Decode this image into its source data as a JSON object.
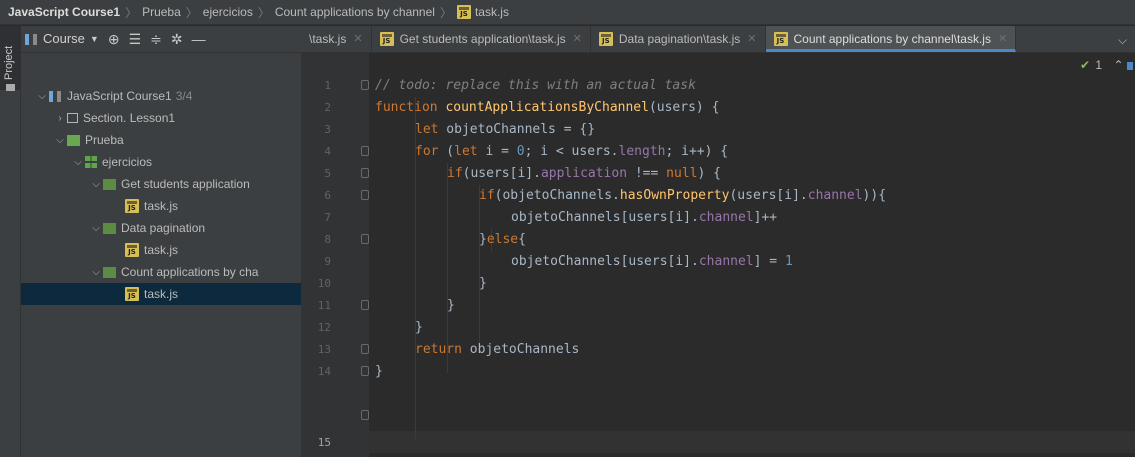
{
  "breadcrumb": {
    "items": [
      "JavaScript Course1",
      "Prueba",
      "ejercicios",
      "Count applications by channel",
      "task.js"
    ]
  },
  "sidestrip": {
    "project_label": "Project"
  },
  "toolbar": {
    "course_label": "Course"
  },
  "tree": {
    "course": {
      "label": "JavaScript Course1",
      "progress": "3/4"
    },
    "section": {
      "label": "Section. Lesson1"
    },
    "prueba": {
      "label": "Prueba"
    },
    "ejercicios": {
      "label": "ejercicios"
    },
    "lessons": [
      {
        "label": "Get students application",
        "file": "task.js"
      },
      {
        "label": "Data pagination",
        "file": "task.js"
      },
      {
        "label": "Count applications by cha",
        "file": "task.js"
      }
    ]
  },
  "tabs": [
    {
      "label": "\\task.js",
      "active": false
    },
    {
      "label": "Get students application\\task.js",
      "active": false
    },
    {
      "label": "Data pagination\\task.js",
      "active": false
    },
    {
      "label": "Count applications by channel\\task.js",
      "active": true
    }
  ],
  "inspection": {
    "count": "1"
  },
  "editor": {
    "current_line": 15,
    "line_numbers": [
      "1",
      "2",
      "3",
      "4",
      "5",
      "6",
      "7",
      "8",
      "9",
      "10",
      "11",
      "12",
      "13",
      "14",
      "15"
    ],
    "code": {
      "l1": "// todo: replace this with an actual task",
      "l2_kw": "function",
      "l2_fn": "countApplicationsByChannel",
      "l2_rest": "(users) {",
      "l3_kw": "let",
      "l3_rest": " objetoChannels = {}",
      "l4_kw1": "for",
      "l4_a": " (",
      "l4_kw2": "let",
      "l4_b": " i = ",
      "l4_num": "0",
      "l4_c": "; i < users.",
      "l4_pr": "length",
      "l4_d": "; i++) {",
      "l5_kw": "if",
      "l5_a": "(users[i].",
      "l5_pr": "application",
      "l5_b": " !== ",
      "l5_kw2": "null",
      "l5_c": ") {",
      "l6_kw": "if",
      "l6_a": "(objetoChannels.",
      "l6_fn": "hasOwnProperty",
      "l6_b": "(users[i].",
      "l6_pr": "channel",
      "l6_c": ")){",
      "l7_a": "objetoChannels[users[i].",
      "l7_pr": "channel",
      "l7_b": "]++",
      "l8_a": "}",
      "l8_kw": "else",
      "l8_b": "{",
      "l9_a": "objetoChannels[users[i].",
      "l9_pr": "channel",
      "l9_b": "] = ",
      "l9_num": "1",
      "l10": "}",
      "l11": "}",
      "l12": "}",
      "l13_kw": "return",
      "l13_rest": " objetoChannels",
      "l14": "}"
    }
  }
}
